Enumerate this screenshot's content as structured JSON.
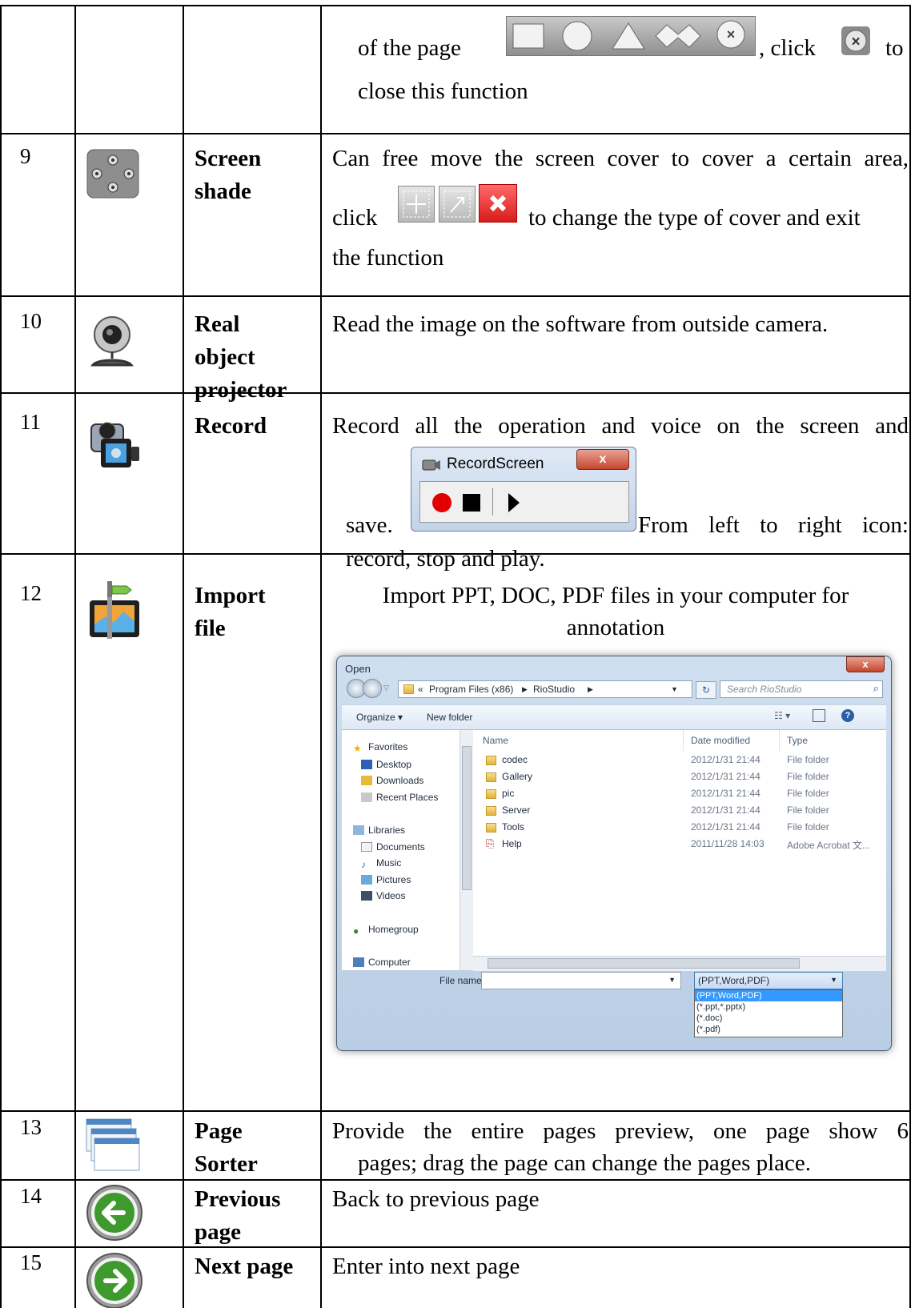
{
  "row8": {
    "desc_before": "of the page",
    "desc_after_strip": ", click",
    "desc_after_close": "to",
    "desc_line2": "close this function"
  },
  "row9": {
    "num": "9",
    "name_line1": "Screen",
    "name_line2": "shade",
    "desc_line1": "Can free move the screen cover to cover a certain area,",
    "desc_click": "click",
    "desc_after_buttons": "to change the type of cover and exit",
    "desc_line3": "the function"
  },
  "row10": {
    "num": "10",
    "name_line1": "Real",
    "name_line2": "object",
    "name_line3": "projector",
    "desc": "Read the image on the software from outside camera."
  },
  "row11": {
    "num": "11",
    "name": "Record",
    "desc_line1": "Record all the operation and voice on the screen and",
    "desc_save": "save.",
    "desc_after_window": "From left to right icon:",
    "desc_line3": "record, stop and play.",
    "recwin_title": "RecordScreen",
    "recwin_close": "x"
  },
  "row12": {
    "num": "12",
    "name_line1": "Import",
    "name_line2": "file",
    "desc_line1": "Import PPT, DOC, PDF files in your computer for",
    "desc_line2": "annotation",
    "dialog": {
      "title": "Open",
      "close": "x",
      "breadcrumb_prefix": "«",
      "breadcrumb_1": "Program Files (x86)",
      "breadcrumb_2": "RioStudio",
      "search_placeholder": "Search RioStudio",
      "organize": "Organize ▾",
      "new_folder": "New folder",
      "nav": {
        "favorites": "Favorites",
        "desktop": "Desktop",
        "downloads": "Downloads",
        "recent": "Recent Places",
        "libraries": "Libraries",
        "documents": "Documents",
        "music": "Music",
        "pictures": "Pictures",
        "videos": "Videos",
        "homegroup": "Homegroup",
        "computer": "Computer"
      },
      "columns": {
        "name": "Name",
        "date": "Date modified",
        "type": "Type"
      },
      "files": [
        {
          "name": "codec",
          "date": "2012/1/31 21:44",
          "type": "File folder"
        },
        {
          "name": "Gallery",
          "date": "2012/1/31 21:44",
          "type": "File folder"
        },
        {
          "name": "pic",
          "date": "2012/1/31 21:44",
          "type": "File folder"
        },
        {
          "name": "Server",
          "date": "2012/1/31 21:44",
          "type": "File folder"
        },
        {
          "name": "Tools",
          "date": "2012/1/31 21:44",
          "type": "File folder"
        },
        {
          "name": "Help",
          "date": "2011/11/28 14:03",
          "type": "Adobe Acrobat 文..."
        }
      ],
      "file_name_label": "File name:",
      "file_type_selected": "(PPT,Word,PDF)",
      "file_type_options": [
        "(PPT,Word,PDF)",
        "(*.ppt,*.pptx)",
        "(*.doc)",
        "(*.pdf)"
      ]
    }
  },
  "row13": {
    "num": "13",
    "name_line1": "Page",
    "name_line2": "Sorter",
    "desc_line1": "Provide the entire pages preview, one page show 6",
    "desc_line2": "pages; drag the page can change the pages place."
  },
  "row14": {
    "num": "14",
    "name_line1": "Previous",
    "name_line2": "page",
    "desc": "Back to previous page"
  },
  "row15": {
    "num": "15",
    "name": "Next page",
    "desc": "Enter into next page"
  },
  "colors": {
    "grid": "#000000",
    "record_red": "#e00000",
    "close_red": "#c5452e",
    "arrow_green": "#3f9a2e",
    "dialog_blue": "#b9cde4"
  }
}
